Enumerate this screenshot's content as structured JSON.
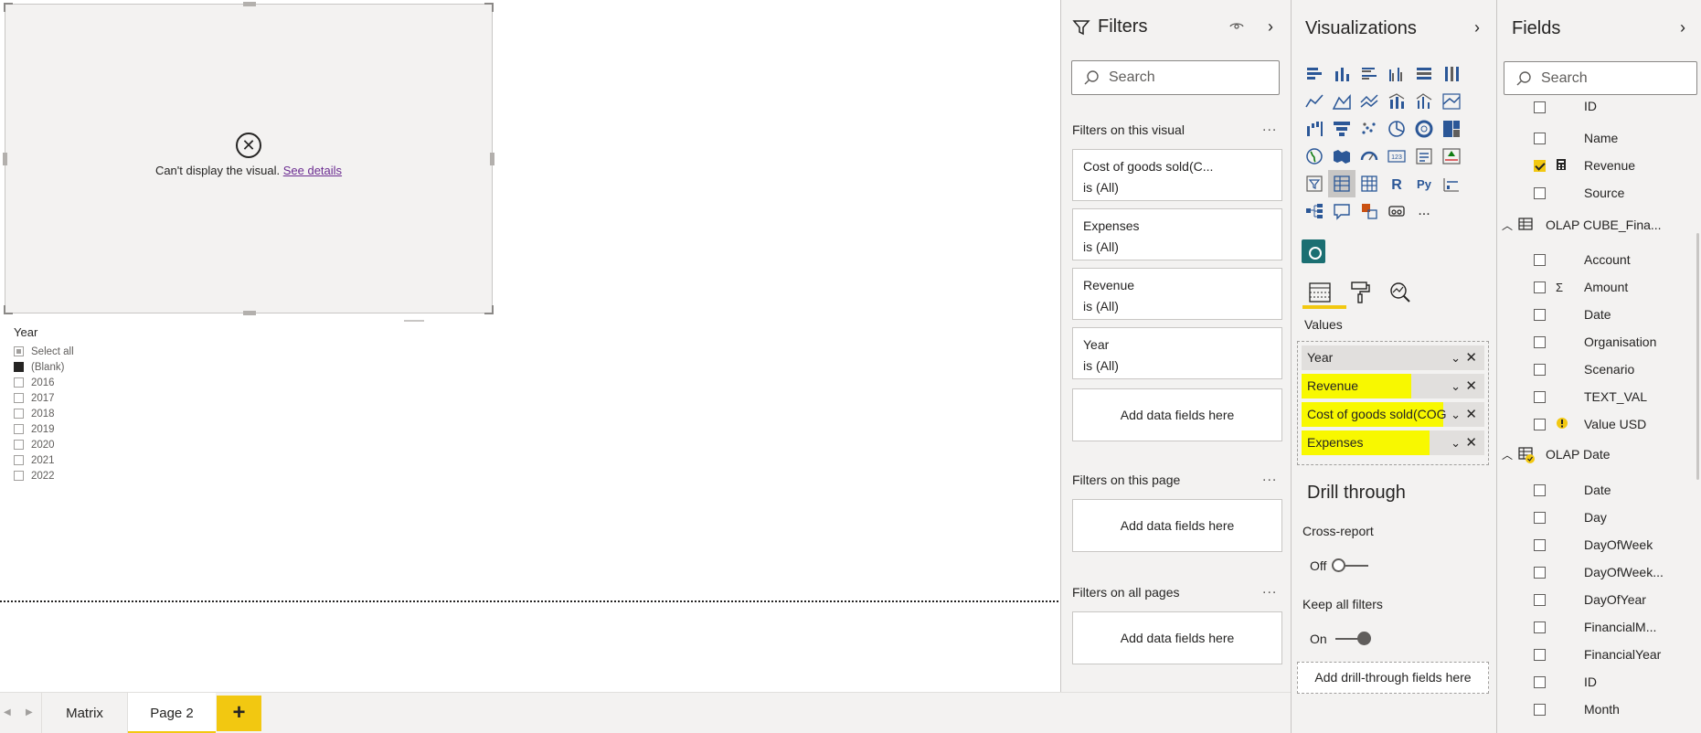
{
  "canvas": {
    "error_message": "Can't display the visual.",
    "see_details": "See details",
    "slicer": {
      "title": "Year",
      "items": [
        "Select all",
        "(Blank)",
        "2016",
        "2017",
        "2018",
        "2019",
        "2020",
        "2021",
        "2022"
      ]
    }
  },
  "tabs": {
    "items": [
      "Matrix",
      "Page 2"
    ],
    "active": "Page 2",
    "add_label": "+"
  },
  "filters": {
    "title": "Filters",
    "search_placeholder": "Search",
    "on_visual_title": "Filters on this visual",
    "visual_filters": [
      {
        "name": "Cost of goods sold(C...",
        "state": "is (All)"
      },
      {
        "name": "Expenses",
        "state": "is (All)"
      },
      {
        "name": "Revenue",
        "state": "is (All)"
      },
      {
        "name": "Year",
        "state": "is (All)"
      }
    ],
    "add_fields_label": "Add data fields here",
    "on_page_title": "Filters on this page",
    "on_all_pages_title": "Filters on all pages",
    "more": "..."
  },
  "visualizations": {
    "title": "Visualizations",
    "values_label": "Values",
    "values_fields": [
      {
        "name": "Year",
        "highlighted": false
      },
      {
        "name": "Revenue",
        "highlighted": true
      },
      {
        "name": "Cost of goods sold(COGS)",
        "highlighted": true
      },
      {
        "name": "Expenses",
        "highlighted": true
      }
    ],
    "highlight_color": "#f8f800",
    "drill_title": "Drill through",
    "cross_report_label": "Cross-report",
    "cross_report_value": "Off",
    "keep_filters_label": "Keep all filters",
    "keep_filters_value": "On",
    "drill_zone_label": "Add drill-through fields here",
    "more_visuals": "..."
  },
  "fields_pane": {
    "title": "Fields",
    "search_placeholder": "Search",
    "top_fields": [
      {
        "name": "ID",
        "checked": false
      },
      {
        "name": "Name",
        "checked": false
      },
      {
        "name": "Revenue",
        "checked": true
      },
      {
        "name": "Source",
        "checked": false
      }
    ],
    "table1": {
      "name": "OLAP CUBE_Fina...",
      "fields": [
        {
          "name": "Account",
          "icon": ""
        },
        {
          "name": "Amount",
          "icon": "Σ"
        },
        {
          "name": "Date",
          "icon": ""
        },
        {
          "name": "Organisation",
          "icon": ""
        },
        {
          "name": "Scenario",
          "icon": ""
        },
        {
          "name": "TEXT_VAL",
          "icon": ""
        },
        {
          "name": "Value USD",
          "icon": "warning"
        }
      ]
    },
    "table2": {
      "name": "OLAP Date",
      "fields": [
        {
          "name": "Date"
        },
        {
          "name": "Day"
        },
        {
          "name": "DayOfWeek"
        },
        {
          "name": "DayOfWeek..."
        },
        {
          "name": "DayOfYear"
        },
        {
          "name": "FinancialM..."
        },
        {
          "name": "FinancialYear"
        },
        {
          "name": "ID"
        },
        {
          "name": "Month"
        }
      ]
    }
  },
  "colors": {
    "accent": "#f2c811",
    "pane_bg": "#f3f2f1",
    "link": "#6b2c91"
  }
}
